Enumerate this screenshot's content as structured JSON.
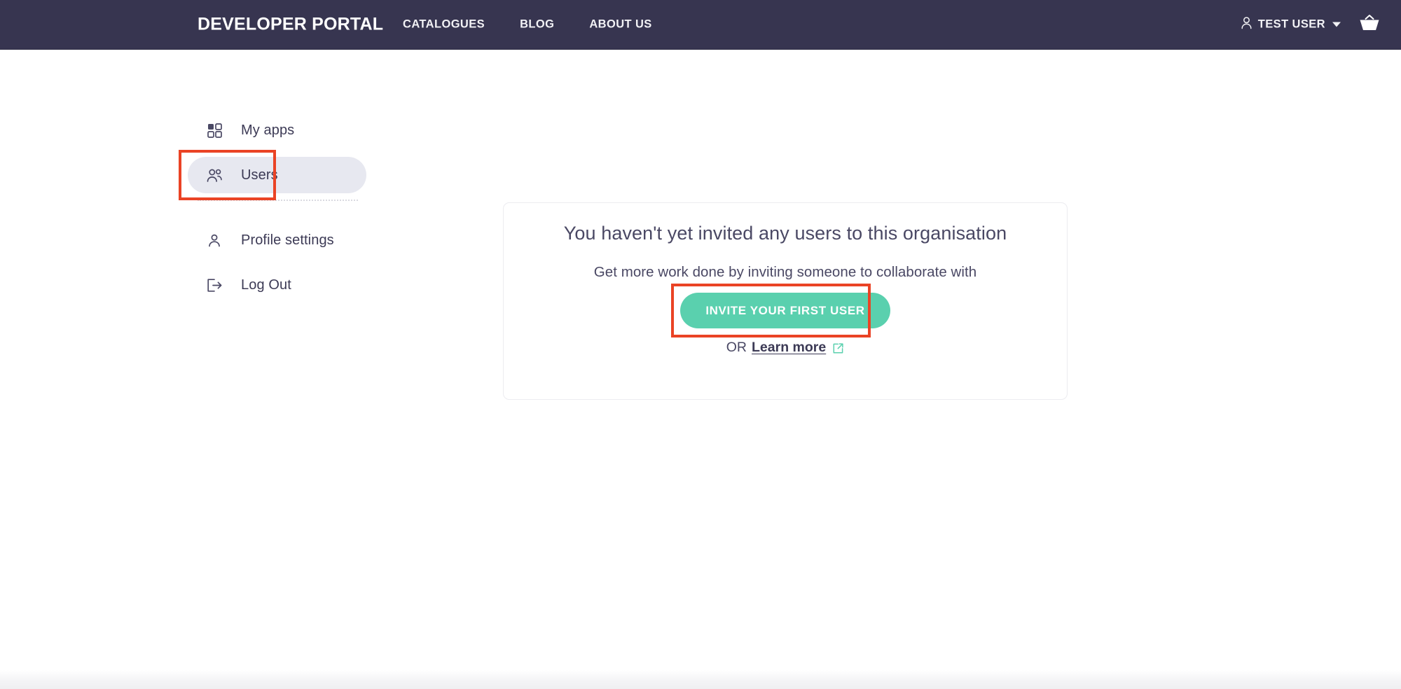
{
  "header": {
    "brand": "DEVELOPER PORTAL",
    "nav": [
      {
        "label": "CATALOGUES",
        "name": "nav-catalogues"
      },
      {
        "label": "BLOG",
        "name": "nav-blog"
      },
      {
        "label": "ABOUT US",
        "name": "nav-about-us"
      }
    ],
    "user": {
      "name": "TEST USER",
      "icon": "person-icon",
      "caret_icon": "chevron-down-icon"
    },
    "cart_icon": "basket-icon",
    "background_color": "#373550",
    "text_color": "#f2f2f5"
  },
  "sidebar": {
    "items": [
      {
        "label": "My apps",
        "icon": "grid-apps-icon",
        "active": false
      },
      {
        "label": "Users",
        "icon": "users-group-icon",
        "active": true
      },
      {
        "label": "Profile settings",
        "icon": "person-outline-icon",
        "active": false
      },
      {
        "label": "Log Out",
        "icon": "logout-icon",
        "active": false
      }
    ],
    "active_background": "#e7e8f0",
    "text_color": "#3c3a55"
  },
  "main": {
    "card": {
      "title": "You haven't yet invited any users to this organisation",
      "subtitle": "Get more work done by inviting someone to collaborate with",
      "cta_label": "INVITE YOUR FIRST USER",
      "cta_color": "#5ad0ae",
      "or_text": "OR",
      "learn_more_label": "Learn more",
      "external_link_icon": "external-link-icon"
    }
  },
  "annotations": {
    "color": "#ea4325",
    "targets": [
      "sidebar-item-users",
      "invite-first-user-button"
    ]
  }
}
